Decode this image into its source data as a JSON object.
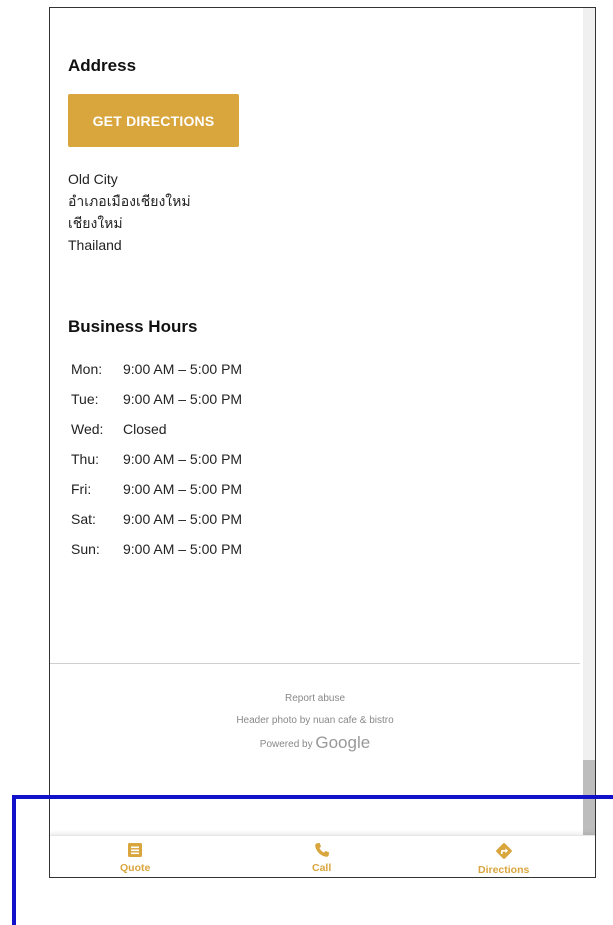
{
  "address": {
    "heading": "Address",
    "directions_button": "GET DIRECTIONS",
    "lines": [
      "Old City",
      "อำเภอเมืองเชียงใหม่",
      "เชียงใหม่",
      "Thailand"
    ]
  },
  "business_hours": {
    "heading": "Business Hours",
    "rows": [
      {
        "day": "Mon:",
        "hours": "9:00 AM – 5:00 PM"
      },
      {
        "day": "Tue:",
        "hours": "9:00 AM – 5:00 PM"
      },
      {
        "day": "Wed:",
        "hours": "Closed"
      },
      {
        "day": "Thu:",
        "hours": "9:00 AM – 5:00 PM"
      },
      {
        "day": "Fri:",
        "hours": "9:00 AM – 5:00 PM"
      },
      {
        "day": "Sat:",
        "hours": "9:00 AM – 5:00 PM"
      },
      {
        "day": "Sun:",
        "hours": "9:00 AM – 5:00 PM"
      }
    ]
  },
  "footer": {
    "report_abuse": "Report abuse",
    "photo_credit": "Header photo by nuan cafe & bistro",
    "powered_by": "Powered by",
    "google": "Google"
  },
  "bottom_bar": {
    "quote": "Quote",
    "call": "Call",
    "directions": "Directions"
  },
  "colors": {
    "accent": "#d9a53d",
    "annotation_blue": "#1111cc"
  }
}
